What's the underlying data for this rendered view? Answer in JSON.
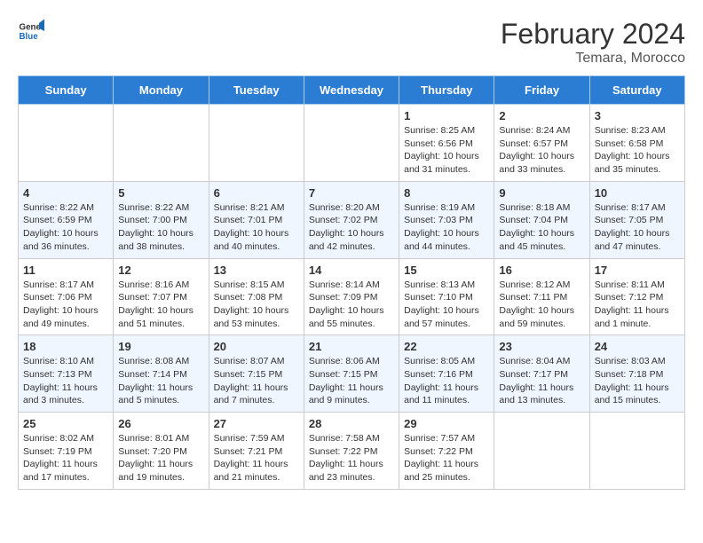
{
  "header": {
    "logo_general": "General",
    "logo_blue": "Blue",
    "title": "February 2024",
    "subtitle": "Temara, Morocco"
  },
  "days_of_week": [
    "Sunday",
    "Monday",
    "Tuesday",
    "Wednesday",
    "Thursday",
    "Friday",
    "Saturday"
  ],
  "weeks": [
    [
      {
        "day": "",
        "info": ""
      },
      {
        "day": "",
        "info": ""
      },
      {
        "day": "",
        "info": ""
      },
      {
        "day": "",
        "info": ""
      },
      {
        "day": "1",
        "info": "Sunrise: 8:25 AM\nSunset: 6:56 PM\nDaylight: 10 hours\nand 31 minutes."
      },
      {
        "day": "2",
        "info": "Sunrise: 8:24 AM\nSunset: 6:57 PM\nDaylight: 10 hours\nand 33 minutes."
      },
      {
        "day": "3",
        "info": "Sunrise: 8:23 AM\nSunset: 6:58 PM\nDaylight: 10 hours\nand 35 minutes."
      }
    ],
    [
      {
        "day": "4",
        "info": "Sunrise: 8:22 AM\nSunset: 6:59 PM\nDaylight: 10 hours\nand 36 minutes."
      },
      {
        "day": "5",
        "info": "Sunrise: 8:22 AM\nSunset: 7:00 PM\nDaylight: 10 hours\nand 38 minutes."
      },
      {
        "day": "6",
        "info": "Sunrise: 8:21 AM\nSunset: 7:01 PM\nDaylight: 10 hours\nand 40 minutes."
      },
      {
        "day": "7",
        "info": "Sunrise: 8:20 AM\nSunset: 7:02 PM\nDaylight: 10 hours\nand 42 minutes."
      },
      {
        "day": "8",
        "info": "Sunrise: 8:19 AM\nSunset: 7:03 PM\nDaylight: 10 hours\nand 44 minutes."
      },
      {
        "day": "9",
        "info": "Sunrise: 8:18 AM\nSunset: 7:04 PM\nDaylight: 10 hours\nand 45 minutes."
      },
      {
        "day": "10",
        "info": "Sunrise: 8:17 AM\nSunset: 7:05 PM\nDaylight: 10 hours\nand 47 minutes."
      }
    ],
    [
      {
        "day": "11",
        "info": "Sunrise: 8:17 AM\nSunset: 7:06 PM\nDaylight: 10 hours\nand 49 minutes."
      },
      {
        "day": "12",
        "info": "Sunrise: 8:16 AM\nSunset: 7:07 PM\nDaylight: 10 hours\nand 51 minutes."
      },
      {
        "day": "13",
        "info": "Sunrise: 8:15 AM\nSunset: 7:08 PM\nDaylight: 10 hours\nand 53 minutes."
      },
      {
        "day": "14",
        "info": "Sunrise: 8:14 AM\nSunset: 7:09 PM\nDaylight: 10 hours\nand 55 minutes."
      },
      {
        "day": "15",
        "info": "Sunrise: 8:13 AM\nSunset: 7:10 PM\nDaylight: 10 hours\nand 57 minutes."
      },
      {
        "day": "16",
        "info": "Sunrise: 8:12 AM\nSunset: 7:11 PM\nDaylight: 10 hours\nand 59 minutes."
      },
      {
        "day": "17",
        "info": "Sunrise: 8:11 AM\nSunset: 7:12 PM\nDaylight: 11 hours\nand 1 minute."
      }
    ],
    [
      {
        "day": "18",
        "info": "Sunrise: 8:10 AM\nSunset: 7:13 PM\nDaylight: 11 hours\nand 3 minutes."
      },
      {
        "day": "19",
        "info": "Sunrise: 8:08 AM\nSunset: 7:14 PM\nDaylight: 11 hours\nand 5 minutes."
      },
      {
        "day": "20",
        "info": "Sunrise: 8:07 AM\nSunset: 7:15 PM\nDaylight: 11 hours\nand 7 minutes."
      },
      {
        "day": "21",
        "info": "Sunrise: 8:06 AM\nSunset: 7:15 PM\nDaylight: 11 hours\nand 9 minutes."
      },
      {
        "day": "22",
        "info": "Sunrise: 8:05 AM\nSunset: 7:16 PM\nDaylight: 11 hours\nand 11 minutes."
      },
      {
        "day": "23",
        "info": "Sunrise: 8:04 AM\nSunset: 7:17 PM\nDaylight: 11 hours\nand 13 minutes."
      },
      {
        "day": "24",
        "info": "Sunrise: 8:03 AM\nSunset: 7:18 PM\nDaylight: 11 hours\nand 15 minutes."
      }
    ],
    [
      {
        "day": "25",
        "info": "Sunrise: 8:02 AM\nSunset: 7:19 PM\nDaylight: 11 hours\nand 17 minutes."
      },
      {
        "day": "26",
        "info": "Sunrise: 8:01 AM\nSunset: 7:20 PM\nDaylight: 11 hours\nand 19 minutes."
      },
      {
        "day": "27",
        "info": "Sunrise: 7:59 AM\nSunset: 7:21 PM\nDaylight: 11 hours\nand 21 minutes."
      },
      {
        "day": "28",
        "info": "Sunrise: 7:58 AM\nSunset: 7:22 PM\nDaylight: 11 hours\nand 23 minutes."
      },
      {
        "day": "29",
        "info": "Sunrise: 7:57 AM\nSunset: 7:22 PM\nDaylight: 11 hours\nand 25 minutes."
      },
      {
        "day": "",
        "info": ""
      },
      {
        "day": "",
        "info": ""
      }
    ]
  ]
}
